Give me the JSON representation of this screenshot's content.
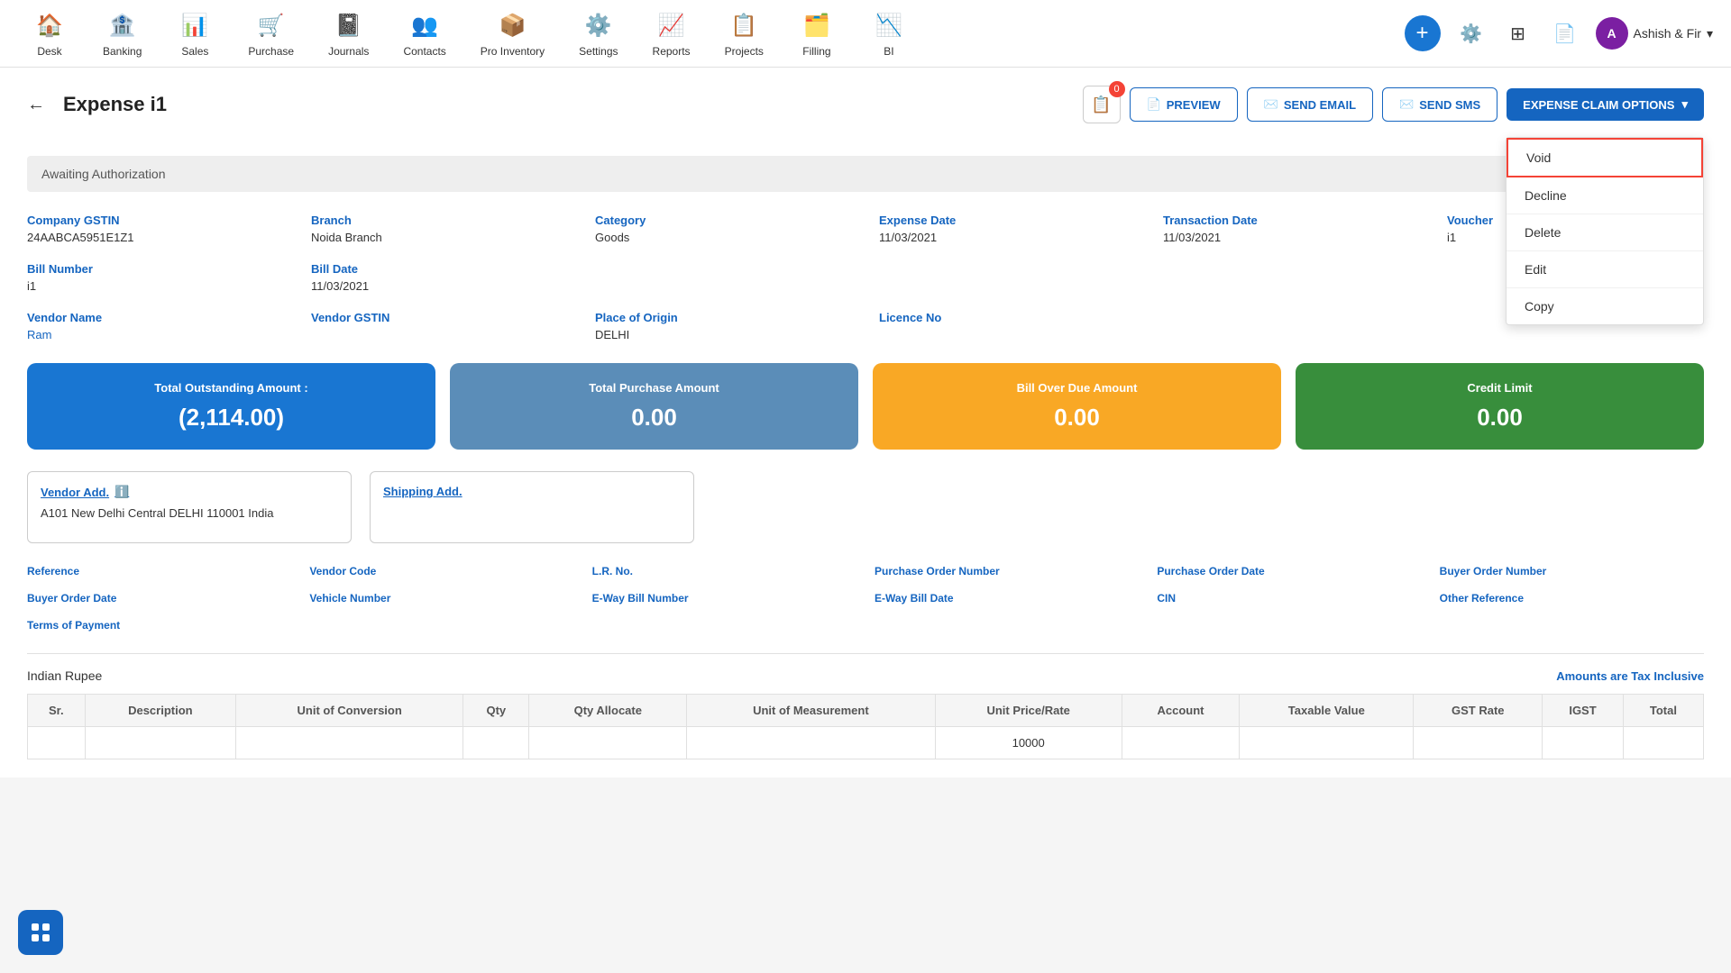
{
  "nav": {
    "items": [
      {
        "id": "desk",
        "label": "Desk",
        "icon": "🏠"
      },
      {
        "id": "banking",
        "label": "Banking",
        "icon": "🏦"
      },
      {
        "id": "sales",
        "label": "Sales",
        "icon": "📊"
      },
      {
        "id": "purchase",
        "label": "Purchase",
        "icon": "🛒"
      },
      {
        "id": "journals",
        "label": "Journals",
        "icon": "📓"
      },
      {
        "id": "contacts",
        "label": "Contacts",
        "icon": "👥"
      },
      {
        "id": "pro_inventory",
        "label": "Pro Inventory",
        "icon": "📦"
      },
      {
        "id": "settings",
        "label": "Settings",
        "icon": "⚙️"
      },
      {
        "id": "reports",
        "label": "Reports",
        "icon": "📈"
      },
      {
        "id": "projects",
        "label": "Projects",
        "icon": "📋"
      },
      {
        "id": "filling",
        "label": "Filling",
        "icon": "🗂️"
      },
      {
        "id": "bi",
        "label": "BI",
        "icon": "📉"
      }
    ],
    "user_label": "Ashish & Fir",
    "notification_count": "0"
  },
  "page": {
    "title": "Expense i1",
    "status": "Awaiting Authorization"
  },
  "buttons": {
    "preview": "PREVIEW",
    "send_email": "SEND EMAIL",
    "send_sms": "SEND SMS",
    "expense_claim": "EXPENSE CLAIM OPTIONS"
  },
  "dropdown": {
    "items": [
      {
        "id": "void",
        "label": "Void",
        "highlighted": true
      },
      {
        "id": "decline",
        "label": "Decline",
        "highlighted": false
      },
      {
        "id": "delete",
        "label": "Delete",
        "highlighted": false
      },
      {
        "id": "edit",
        "label": "Edit",
        "highlighted": false
      },
      {
        "id": "copy",
        "label": "Copy",
        "highlighted": false
      }
    ]
  },
  "form": {
    "company_gstin_label": "Company GSTIN",
    "company_gstin_value": "24AABCA5951E1Z1",
    "branch_label": "Branch",
    "branch_value": "Noida Branch",
    "category_label": "Category",
    "category_value": "Goods",
    "expense_date_label": "Expense Date",
    "expense_date_value": "11/03/2021",
    "transaction_date_label": "Transaction Date",
    "transaction_date_value": "11/03/2021",
    "voucher_label": "Voucher",
    "voucher_value": "i1",
    "bill_number_label": "Bill Number",
    "bill_number_value": "i1",
    "bill_date_label": "Bill Date",
    "bill_date_value": "11/03/2021",
    "vendor_name_label": "Vendor Name",
    "vendor_name_value": "Ram",
    "vendor_gstin_label": "Vendor GSTIN",
    "vendor_gstin_value": "",
    "place_of_origin_label": "Place of Origin",
    "place_of_origin_value": "DELHI",
    "licence_no_label": "Licence No",
    "licence_no_value": ""
  },
  "cards": {
    "outstanding": {
      "title": "Total Outstanding Amount :",
      "value": "(2,114.00)"
    },
    "purchase": {
      "title": "Total Purchase Amount",
      "value": "0.00"
    },
    "overdue": {
      "title": "Bill Over Due Amount",
      "value": "0.00"
    },
    "credit": {
      "title": "Credit Limit",
      "value": "0.00"
    }
  },
  "address": {
    "vendor_label": "Vendor Add.",
    "vendor_value": "A101 New Delhi Central DELHI 110001 India",
    "shipping_label": "Shipping Add.",
    "shipping_value": ""
  },
  "detail_fields": {
    "row1": [
      {
        "label": "Reference",
        "value": ""
      },
      {
        "label": "Vendor Code",
        "value": ""
      },
      {
        "label": "L.R. No.",
        "value": ""
      },
      {
        "label": "Purchase Order Number",
        "value": ""
      },
      {
        "label": "Purchase Order Date",
        "value": ""
      },
      {
        "label": "Buyer Order Number",
        "value": ""
      }
    ],
    "row2": [
      {
        "label": "Buyer Order Date",
        "value": ""
      },
      {
        "label": "Vehicle Number",
        "value": ""
      },
      {
        "label": "E-Way Bill Number",
        "value": ""
      },
      {
        "label": "E-Way Bill Date",
        "value": ""
      },
      {
        "label": "CIN",
        "value": ""
      },
      {
        "label": "Other Reference",
        "value": ""
      }
    ],
    "row3": [
      {
        "label": "Terms of Payment",
        "value": ""
      }
    ]
  },
  "table": {
    "currency": "Indian Rupee",
    "tax_note": "Amounts are Tax Inclusive",
    "headers": [
      "Sr.",
      "Description",
      "Unit of Conversion",
      "Qty",
      "Qty Allocate",
      "Unit of Measurement",
      "Unit Price/Rate",
      "Account",
      "Taxable Value",
      "GST Rate",
      "IGST",
      "Total"
    ]
  }
}
